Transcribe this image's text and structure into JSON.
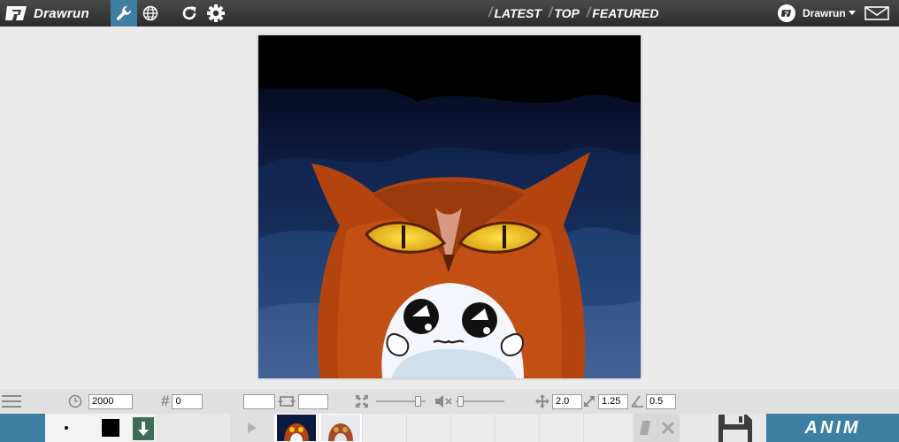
{
  "header": {
    "logo_text": "Drawrun",
    "nav": [
      {
        "label": "LATEST"
      },
      {
        "label": "TOP"
      },
      {
        "label": "FEATURED"
      }
    ],
    "user_name": "Drawrun",
    "icons": [
      "wrench-icon",
      "globe-icon",
      "refresh-icon",
      "gear-icon",
      "caret-down-icon",
      "mail-icon"
    ],
    "accent_color": "#3d7ea3"
  },
  "controls": {
    "frame_delay": "2000",
    "frame_number": "0",
    "loop_start": "",
    "loop_end": "",
    "zoom_slider_level": 0.9,
    "volume_slider_level": 0.05,
    "move_value": "2.0",
    "scale_value": "1.25",
    "angle_value": "0.5"
  },
  "bottom": {
    "brush_color": "#000000",
    "anim_label": "ANIM"
  }
}
